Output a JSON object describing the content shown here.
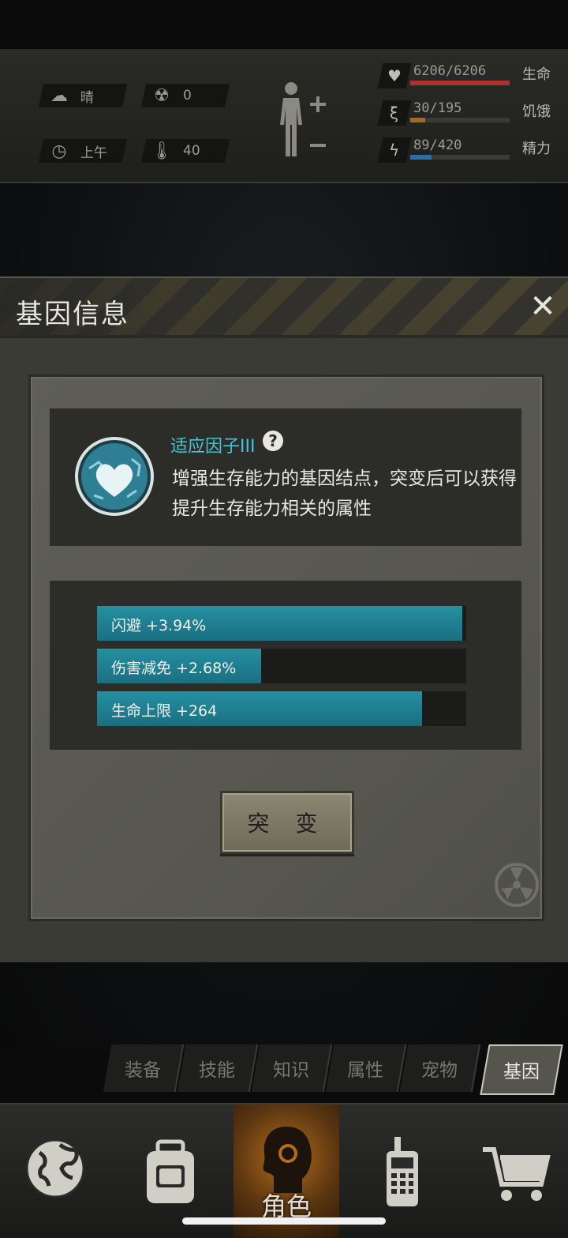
{
  "status": {
    "weather": {
      "icon": "cloud-sun-icon",
      "label": "晴"
    },
    "radiation": {
      "icon": "radiation-icon",
      "value": "0"
    },
    "time": {
      "icon": "clock-icon",
      "label": "上午"
    },
    "temperature": {
      "icon": "thermometer-icon",
      "value": "40"
    },
    "vitals": [
      {
        "icon": "heart-icon",
        "value": "6206/6206",
        "label": "生命",
        "fraction": 1.0,
        "color": "#b0302a"
      },
      {
        "icon": "stomach-icon",
        "value": "30/195",
        "label": "饥饿",
        "fraction": 0.154,
        "color": "#a06a2a"
      },
      {
        "icon": "energy-icon",
        "value": "89/420",
        "label": "精力",
        "fraction": 0.212,
        "color": "#2a6fa8"
      }
    ]
  },
  "modal": {
    "title": "基因信息",
    "gene": {
      "name": "适应因子III",
      "description": "增强生存能力的基因结点，突变后可以获得提升生存能力相关的属性"
    },
    "stats": [
      {
        "label": "闪避 +3.94%",
        "fraction": 0.99
      },
      {
        "label": "伤害减免 +2.68%",
        "fraction": 0.445
      },
      {
        "label": "生命上限 +264",
        "fraction": 0.88
      }
    ],
    "action_label": "突 变"
  },
  "tabs": [
    {
      "label": "装备",
      "active": false
    },
    {
      "label": "技能",
      "active": false
    },
    {
      "label": "知识",
      "active": false
    },
    {
      "label": "属性",
      "active": false
    },
    {
      "label": "宠物",
      "active": false
    },
    {
      "label": "基因",
      "active": true
    }
  ],
  "nav": [
    {
      "icon": "globe-icon",
      "label": ""
    },
    {
      "icon": "backpack-icon",
      "label": ""
    },
    {
      "icon": "character-head-icon",
      "label": "角色",
      "active": true
    },
    {
      "icon": "radio-icon",
      "label": ""
    },
    {
      "icon": "cart-icon",
      "label": ""
    }
  ]
}
